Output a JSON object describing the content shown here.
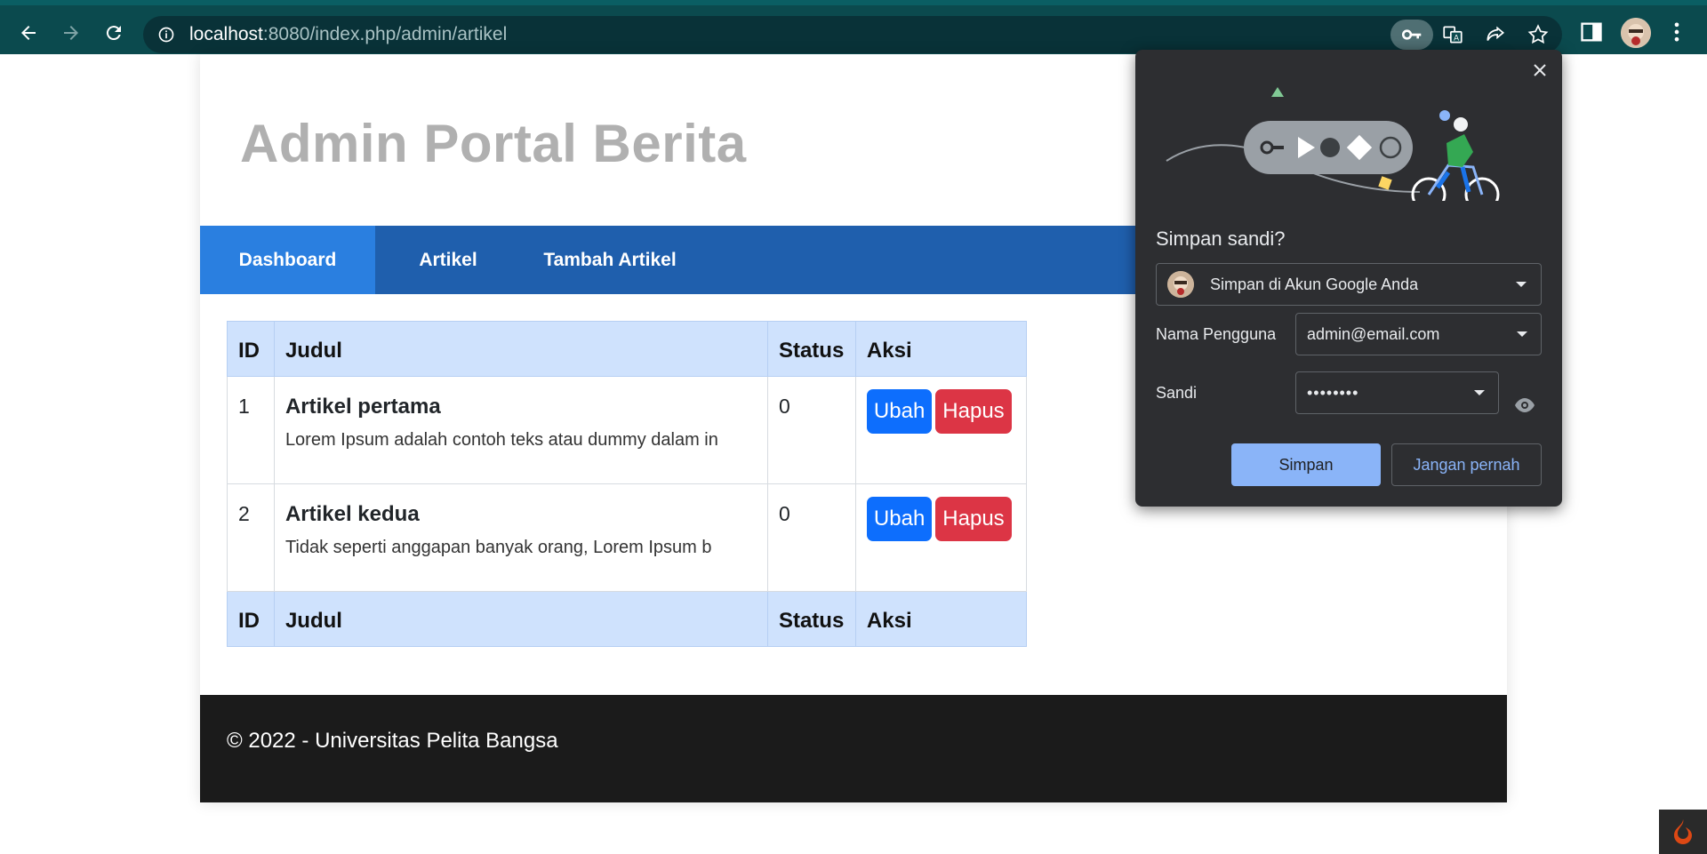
{
  "browser": {
    "url_host": "localhost",
    "url_rest": ":8080/index.php/admin/artikel"
  },
  "site": {
    "title": "Admin Portal Berita",
    "nav": [
      {
        "label": "Dashboard",
        "active": true
      },
      {
        "label": "Artikel",
        "active": false
      },
      {
        "label": "Tambah Artikel",
        "active": false
      }
    ]
  },
  "table": {
    "headers": [
      "ID",
      "Judul",
      "Status",
      "Aksi"
    ],
    "rows": [
      {
        "id": "1",
        "title": "Artikel pertama",
        "desc": "Lorem Ipsum adalah contoh teks atau dummy dalam in",
        "status": "0",
        "edit": "Ubah",
        "delete": "Hapus"
      },
      {
        "id": "2",
        "title": "Artikel kedua",
        "desc": "Tidak seperti anggapan banyak orang, Lorem Ipsum b",
        "status": "0",
        "edit": "Ubah",
        "delete": "Hapus"
      }
    ],
    "footers": [
      "ID",
      "Judul",
      "Status",
      "Aksi"
    ]
  },
  "footer": {
    "text": "© 2022 - Universitas Pelita Bangsa"
  },
  "password_popup": {
    "heading": "Simpan sandi?",
    "account": "Simpan di Akun Google Anda",
    "username_label": "Nama Pengguna",
    "username_value": "admin@email.com",
    "password_label": "Sandi",
    "password_value": "••••••••",
    "save_label": "Simpan",
    "never_label": "Jangan pernah"
  },
  "colors": {
    "nav_bg": "#1f5fad",
    "nav_active": "#2a7fe0",
    "edit_button": "#0d6efd",
    "delete_button": "#dc3545",
    "popup_bg": "#2d2e31",
    "popup_accent": "#8ab4f8"
  }
}
